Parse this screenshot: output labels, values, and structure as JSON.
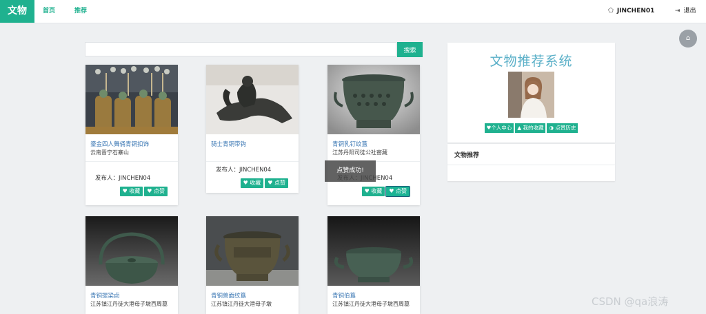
{
  "nav": {
    "brand": "文物",
    "links": [
      "首页",
      "推荐"
    ],
    "username": "JINCHEN01",
    "logout": "退出"
  },
  "search": {
    "placeholder": "",
    "button": "搜索"
  },
  "cards": [
    {
      "title": "鎏金四人舞俑青铜扣饰",
      "location": "云南晋宁石寨山",
      "publisher": "发布人：JINCHEN04",
      "fav": "收藏",
      "like": "点赞"
    },
    {
      "title": "骑士青铜带钩",
      "location": "",
      "publisher": "发布人：JINCHEN04",
      "fav": "收藏",
      "like": "点赞"
    },
    {
      "title": "青铜乳钉纹簋",
      "location": "江苏丹阳司徒公社窖藏",
      "publisher": "发布人：JINCHEN04",
      "fav": "收藏",
      "like": "点赞"
    },
    {
      "title": "青铜提梁卣",
      "location": "江苏镇江丹徒大港母子墩西周墓"
    },
    {
      "title": "青铜兽面纹簋",
      "location": "江苏镇江丹徒大港母子墩"
    },
    {
      "title": "青铜伯簋",
      "location": "江苏镇江丹徒大港母子墩西周墓"
    }
  ],
  "sidebar": {
    "system_title": "文物推荐系统",
    "buttons": [
      "个人中心",
      "我的收藏",
      "点赞历史"
    ],
    "recommend_title": "文物推荐"
  },
  "toast": "点赞成功!",
  "watermark": "CSDN @qa浪涛",
  "colors": {
    "accent": "#1fb18f",
    "link": "#3c78b4",
    "system_title": "#5bb0c8"
  },
  "icons": [
    "user-icon",
    "logout-icon",
    "home-icon",
    "heart-icon",
    "thumbs-up-icon",
    "history-icon"
  ]
}
